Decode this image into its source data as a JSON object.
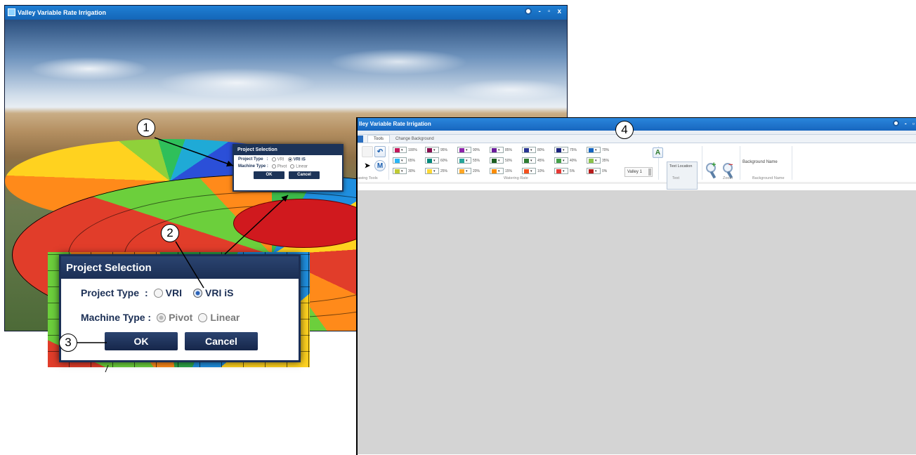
{
  "callouts": [
    "1",
    "2",
    "3",
    "4"
  ],
  "splash_window": {
    "title": "Valley Variable Rate Irrigation",
    "controls": [
      "-",
      "▫",
      "x"
    ],
    "dialog": {
      "title": "Project Selection",
      "project_type_label": "Project Type",
      "separator": ":",
      "project_options": [
        "VRI",
        "VRI iS"
      ],
      "project_selected": "VRI iS",
      "machine_type_label": "Machine Type :",
      "machine_options": [
        "Pivot",
        "Linear"
      ],
      "machine_selected": "Pivot",
      "ok_label": "OK",
      "cancel_label": "Cancel"
    }
  },
  "zoom_dialog": {
    "title": "Project Selection",
    "project_type_label": "Project Type",
    "separator": ":",
    "project_options": [
      "VRI",
      "VRI iS"
    ],
    "project_selected": "VRI iS",
    "machine_type_label": "Machine Type :",
    "machine_options": [
      "Pivot",
      "Linear"
    ],
    "machine_selected": "Pivot",
    "ok_label": "OK",
    "cancel_label": "Cancel"
  },
  "main_window": {
    "title": "lley Variable Rate Irrigation",
    "controls": [
      "-",
      "▫"
    ],
    "tabs": [
      "Tools",
      "Change Background"
    ],
    "active_tab": "Tools",
    "groups": {
      "drawing_tools": "awing Tools",
      "watering_rate": "Watering Rate",
      "text": "Text",
      "zoom": "Zoom",
      "background_name": "Background Name"
    },
    "swatches": [
      {
        "pct": "100%",
        "color": "#c2185b"
      },
      {
        "pct": "95%",
        "color": "#880e4f"
      },
      {
        "pct": "90%",
        "color": "#8e24aa"
      },
      {
        "pct": "85%",
        "color": "#6a1b9a"
      },
      {
        "pct": "80%",
        "color": "#283593"
      },
      {
        "pct": "75%",
        "color": "#1a237e"
      },
      {
        "pct": "70%",
        "color": "#1565c0"
      },
      {
        "pct": "65%",
        "color": "#29b6f6"
      },
      {
        "pct": "60%",
        "color": "#00897b"
      },
      {
        "pct": "55%",
        "color": "#26a69a"
      },
      {
        "pct": "50%",
        "color": "#1b5e20"
      },
      {
        "pct": "45%",
        "color": "#2e7d32"
      },
      {
        "pct": "40%",
        "color": "#43a047"
      },
      {
        "pct": "35%",
        "color": "#8bc34a"
      },
      {
        "pct": "30%",
        "color": "#c0ca33"
      },
      {
        "pct": "25%",
        "color": "#fdd835"
      },
      {
        "pct": "20%",
        "color": "#ffa726"
      },
      {
        "pct": "15%",
        "color": "#fb8c00"
      },
      {
        "pct": "10%",
        "color": "#f4511e"
      },
      {
        "pct": "5%",
        "color": "#e53935"
      },
      {
        "pct": "0%",
        "color": "#b71c1c"
      }
    ],
    "valley_label": "Valley 1",
    "text_tools": [
      "Text",
      "Location"
    ],
    "background_name_field": "Background Name"
  }
}
